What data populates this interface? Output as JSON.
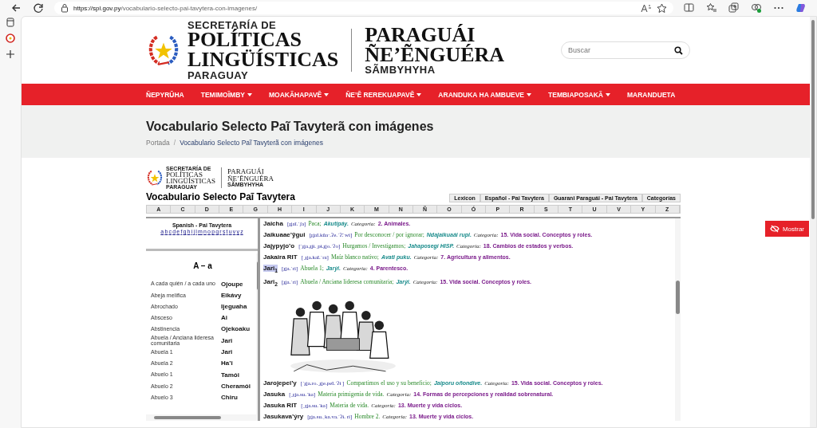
{
  "browser": {
    "url": {
      "host": "https://spl.gov.py",
      "path": "/vocabulario-selecto-pai-tavytera-con-imagenes/"
    }
  },
  "site": {
    "logo": {
      "line1": "SECRETARÍA DE",
      "line2": "POLÍTICAS",
      "line3": "LINGÜÍSTICAS",
      "line4": "PARAGUAY"
    },
    "logo_right": {
      "line1": "PARAGUÁI",
      "line2": "ÑE’ẼNGUÉRA",
      "line3": "SÃMBYHYHA"
    },
    "search": {
      "placeholder": "Buscar"
    }
  },
  "nav": [
    {
      "label": "ÑEPYRŨHA",
      "dropdown": false
    },
    {
      "label": "TEMIMOĨMBY",
      "dropdown": true
    },
    {
      "label": "MOAKÃHAPAVẼ",
      "dropdown": true
    },
    {
      "label": "ÑE’Ẽ REREKUAPAVẼ",
      "dropdown": true
    },
    {
      "label": "ARANDUKA HA AMBUEVE",
      "dropdown": true
    },
    {
      "label": "TEMBIAPOSAKÃ",
      "dropdown": true
    },
    {
      "label": "MARANDUETA",
      "dropdown": false
    }
  ],
  "page_title": "Vocabulario Selecto Paĩ Tavyterã con imágenes",
  "breadcrumb": {
    "items": [
      "Portada",
      "Vocabulario Selecto Paĩ Tavyterã con imágenes"
    ],
    "separator": "/"
  },
  "vocabulary": {
    "logo": {
      "line1": "SECRETARÍA DE",
      "line2": "POLÍTICAS",
      "line3": "LINGÜÍSTICAS",
      "line4": "PARAGUAY",
      "right1": "PARAGUÁI",
      "right2": "ÑE’ẼNGUÉRA",
      "right3": "SÃMBYHYHA"
    },
    "title": "Vocabulario Selecto Paĩ Tavytera",
    "tabs": [
      "Lexicon",
      "Español - Pai Tavytera",
      "Guarani Paraguái - Pai Tavytera",
      "Categorías"
    ],
    "letters": [
      "A",
      "C",
      "D",
      "E",
      "G",
      "H",
      "I",
      "J",
      "K",
      "M",
      "N",
      "Ñ",
      "O",
      "Ó",
      "P",
      "R",
      "S",
      "T",
      "U",
      "V",
      "Y",
      "Z"
    ],
    "index": {
      "heading": "Spanish - Pai Tavytera",
      "letters": [
        "a",
        "b",
        "c",
        "d",
        "e",
        "f",
        "g",
        "h",
        "i",
        "j",
        "l",
        "m",
        "n",
        "o",
        "p",
        "q",
        "r",
        "s",
        "t",
        "u",
        "v",
        "y",
        "z"
      ],
      "section": "A – a",
      "entries": [
        {
          "spanish": "A cada quién / a cada uno",
          "pai": "Ojoupe"
        },
        {
          "spanish": "Abeja melífica",
          "pai": "Eikávy"
        },
        {
          "spanish": "Abrochado",
          "pai": "Ijeguaha"
        },
        {
          "spanish": "Absceso",
          "pai": "Ai"
        },
        {
          "spanish": "Abstinencia",
          "pai": "Ojekoaku"
        },
        {
          "spanish": "Abuela / Anciana lideresa comunitaria",
          "pai": "Jari"
        },
        {
          "spanish": "Abuela 1",
          "pai": "Jari"
        },
        {
          "spanish": "Abuela 2",
          "pai": "Ha’i"
        },
        {
          "spanish": "Abuelo 1",
          "pai": "Tamói"
        },
        {
          "spanish": "Abuelo 2",
          "pai": "Cheramói"
        },
        {
          "spanish": "Abuelo 3",
          "pai": "Chiru"
        }
      ]
    },
    "entries": [
      {
        "kind": "entry",
        "headword": "Jaicha",
        "highlighted": false,
        "ipa": "[ɟʝaĩ.ˈʃa]",
        "gloss": "Paca;",
        "example": "Akutipáy.",
        "category_label": "Categoría:",
        "category": "2. Animales."
      },
      {
        "kind": "entry",
        "headword": "Jaikuaae’ỹgui",
        "highlighted": false,
        "ipa": "[ɟʝaĩ.kũa·.ʔe.ˈʔ̃. wi]",
        "gloss": "Por desconocer / por ignorar;",
        "example": "Ndajaikuaái rupi.",
        "category_label": "Categoría:",
        "category": "15. Vida social. Conceptos y roles."
      },
      {
        "kind": "entry",
        "headword": "Jajypyjo’o",
        "highlighted": false,
        "ipa": "[ˈɟʝa.ɟʝɨ.ˌpɨ.ɟʝo.ˈʔo]",
        "gloss": "Hurgamos / Investigamos;",
        "example": "Jahaposegí HISP.",
        "category_label": "Categoría:",
        "category": "18. Cambios de estados y verbos."
      },
      {
        "kind": "entry",
        "headword": "Jakaira RIT",
        "highlighted": false,
        "ipa": "[ˌɟʝa.kaĩ.ˈra]",
        "gloss": "Maíz blanco nativo;",
        "example": "Avati puku.",
        "category_label": "Categoría:",
        "category": "7. Agricultura y alimentos."
      },
      {
        "kind": "entry",
        "headword": "Jari$_{1}$",
        "highlighted": true,
        "ipa": "[ɟʝa.ˈri]",
        "gloss": "Abuela 1;",
        "example": "Jarýi.",
        "category_label": "Categoría:",
        "category": "4. Parentesco."
      },
      {
        "kind": "entry",
        "headword": "Jari$_{2}$",
        "highlighted": false,
        "ipa": "[ɟʝa.ˈri]",
        "gloss": "Abuela / Anciana lideresa comunitaria;",
        "example": "Jarýi.",
        "category_label": "Categoría:",
        "category": "15. Vida social. Conceptos y roles."
      },
      {
        "kind": "picture"
      },
      {
        "kind": "entry",
        "headword": "Jarojepei’y",
        "highlighted": false,
        "ipa": "[ˈɟʝa.ro.ˌɟʝe.peĩ.ˈʔɨ ]",
        "gloss": "Compartimos el uso y su beneficio;",
        "example": "Jaiporu oñondive.",
        "category_label": "Categoría:",
        "category": "15. Vida social. Conceptos y roles."
      },
      {
        "kind": "entry",
        "headword": "Jasuka",
        "highlighted": false,
        "ipa": "[ˌɟʝa.su.ˈka]",
        "gloss": "Materia primigenia de vida.",
        "category_label": "Categoría:",
        "category": "14. Formas de percepciones y realidad sobrenatural."
      },
      {
        "kind": "entry",
        "headword": "Jasuka RIT",
        "highlighted": false,
        "ipa": "[ˌɟʝa.su.ˈka]",
        "gloss": "Materia de vida.",
        "category_label": "Categoría:",
        "category": "13. Muerte y vida ciclos."
      },
      {
        "kind": "entry",
        "headword": "Jasukava’ýry",
        "highlighted": false,
        "ipa": "[ɟʝa.su.ˌka.va.ˈʔɨ. ri]",
        "gloss": "Hombre 2.",
        "category_label": "Categoría:",
        "category": "13. Muerte y vida ciclos."
      }
    ]
  },
  "show_button": {
    "label": "Mostrar"
  }
}
